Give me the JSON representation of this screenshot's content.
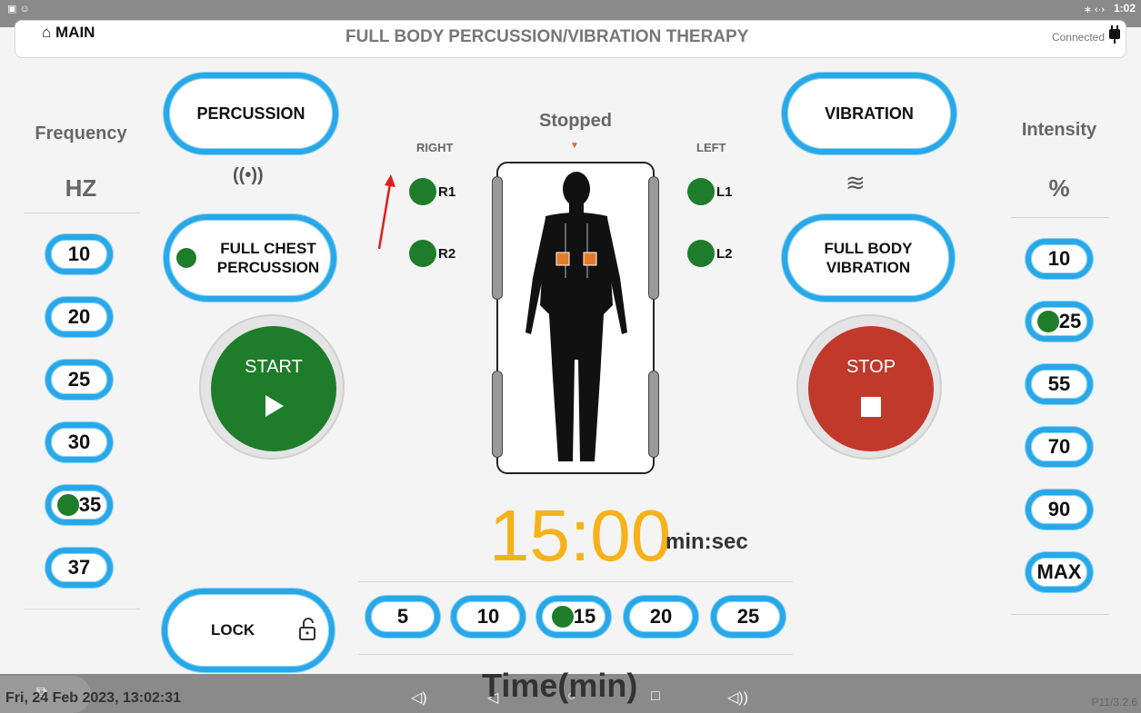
{
  "statusbar": {
    "time": "1:02",
    "bt": "∗ ‹·›"
  },
  "header": {
    "main_label": "MAIN",
    "title": "FULL BODY PERCUSSION/VIBRATION THERAPY",
    "connection": "Connected"
  },
  "left": {
    "title": "Frequency",
    "unit": "HZ",
    "values": [
      "10",
      "20",
      "25",
      "30",
      "35",
      "37"
    ],
    "selected": "35"
  },
  "right": {
    "title": "Intensity",
    "unit": "%",
    "values": [
      "10",
      "25",
      "55",
      "70",
      "90",
      "MAX"
    ],
    "selected": "25"
  },
  "buttons": {
    "percussion": "PERCUSSION",
    "vibration": "VIBRATION",
    "full_chest": "FULL CHEST PERCUSSION",
    "full_body": "FULL BODY VIBRATION",
    "start": "START",
    "stop": "STOP",
    "lock": "LOCK"
  },
  "icons": {
    "percussion": "((•))",
    "vibration": "≋"
  },
  "status": "Stopped",
  "sides": {
    "right": "RIGHT",
    "left": "LEFT"
  },
  "sites": {
    "r1": "R1",
    "r2": "R2",
    "l1": "L1",
    "l2": "L2"
  },
  "timer": {
    "value": "15:00",
    "unit": "min:sec"
  },
  "time": {
    "options": [
      "5",
      "10",
      "15",
      "20",
      "25"
    ],
    "selected": "15",
    "caption": "Time(min)"
  },
  "footer": {
    "datetime": "Fri, 24 Feb 2023, 13:02:31",
    "version": "P11/3.2.6"
  },
  "colors": {
    "accent": "#29a8e8",
    "active": "#1e7d2a",
    "start": "#1e7d2a",
    "stop": "#c0392b",
    "timer": "#f7b21a"
  }
}
